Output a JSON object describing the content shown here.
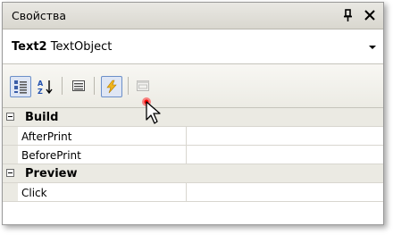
{
  "panel": {
    "title": "Свойства",
    "title_bar_icons": [
      "pin-icon",
      "close-icon"
    ]
  },
  "object_selector": {
    "name": "Text2",
    "type": "TextObject"
  },
  "toolbar": {
    "buttons": [
      {
        "icon": "categorized-icon",
        "checked": true
      },
      {
        "icon": "alphabetical-icon",
        "checked": false
      },
      {
        "icon": "properties-icon",
        "checked": false
      },
      {
        "icon": "events-icon",
        "checked": true
      },
      {
        "icon": "property-pages-icon",
        "checked": false,
        "disabled": true
      }
    ]
  },
  "grid": {
    "categories": [
      {
        "label": "Build",
        "items": [
          {
            "name": "AfterPrint",
            "value": ""
          },
          {
            "name": "BeforePrint",
            "value": ""
          }
        ]
      },
      {
        "label": "Preview",
        "items": [
          {
            "name": "Click",
            "value": ""
          }
        ]
      }
    ]
  },
  "colors": {
    "titlebar": "#d9d7cf",
    "category_bg": "#ebeae3",
    "checked_button_border": "#6b8fc9",
    "events_icon": "#f2b51a"
  }
}
